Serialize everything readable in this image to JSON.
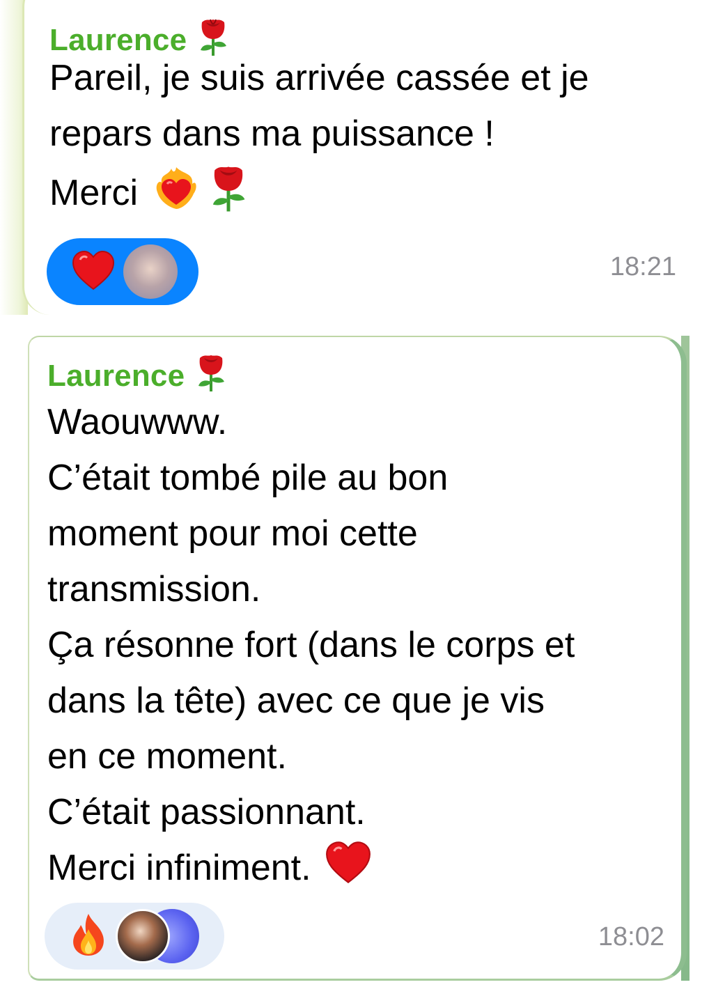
{
  "messages": [
    {
      "sender": "Laurence",
      "text": "Pareil, je suis arrivée cassée et je\nrepars dans ma puissance !\nMerci",
      "time": "18:21",
      "reactions": [
        {
          "icon": "heart-icon"
        }
      ]
    },
    {
      "sender": "Laurence",
      "text": "Waouwww.\nC’était tombé pile au bon\nmoment pour moi cette\ntransmission.\nÇa résonne fort (dans le corps et\ndans la tête) avec ce que je vis\nen ce moment.\nC’était passionnant.\nMerci infiniment.",
      "time": "18:02",
      "reactions": [
        {
          "icon": "fire-icon"
        }
      ]
    }
  ],
  "colors": {
    "sender_name": "#4bae2b",
    "time": "#8e8e93",
    "reaction_active_bg": "#0a84ff",
    "reaction_inactive_bg": "#e6eef9",
    "heart": "#e8141c",
    "wallpaper": "#8dbd8f"
  }
}
